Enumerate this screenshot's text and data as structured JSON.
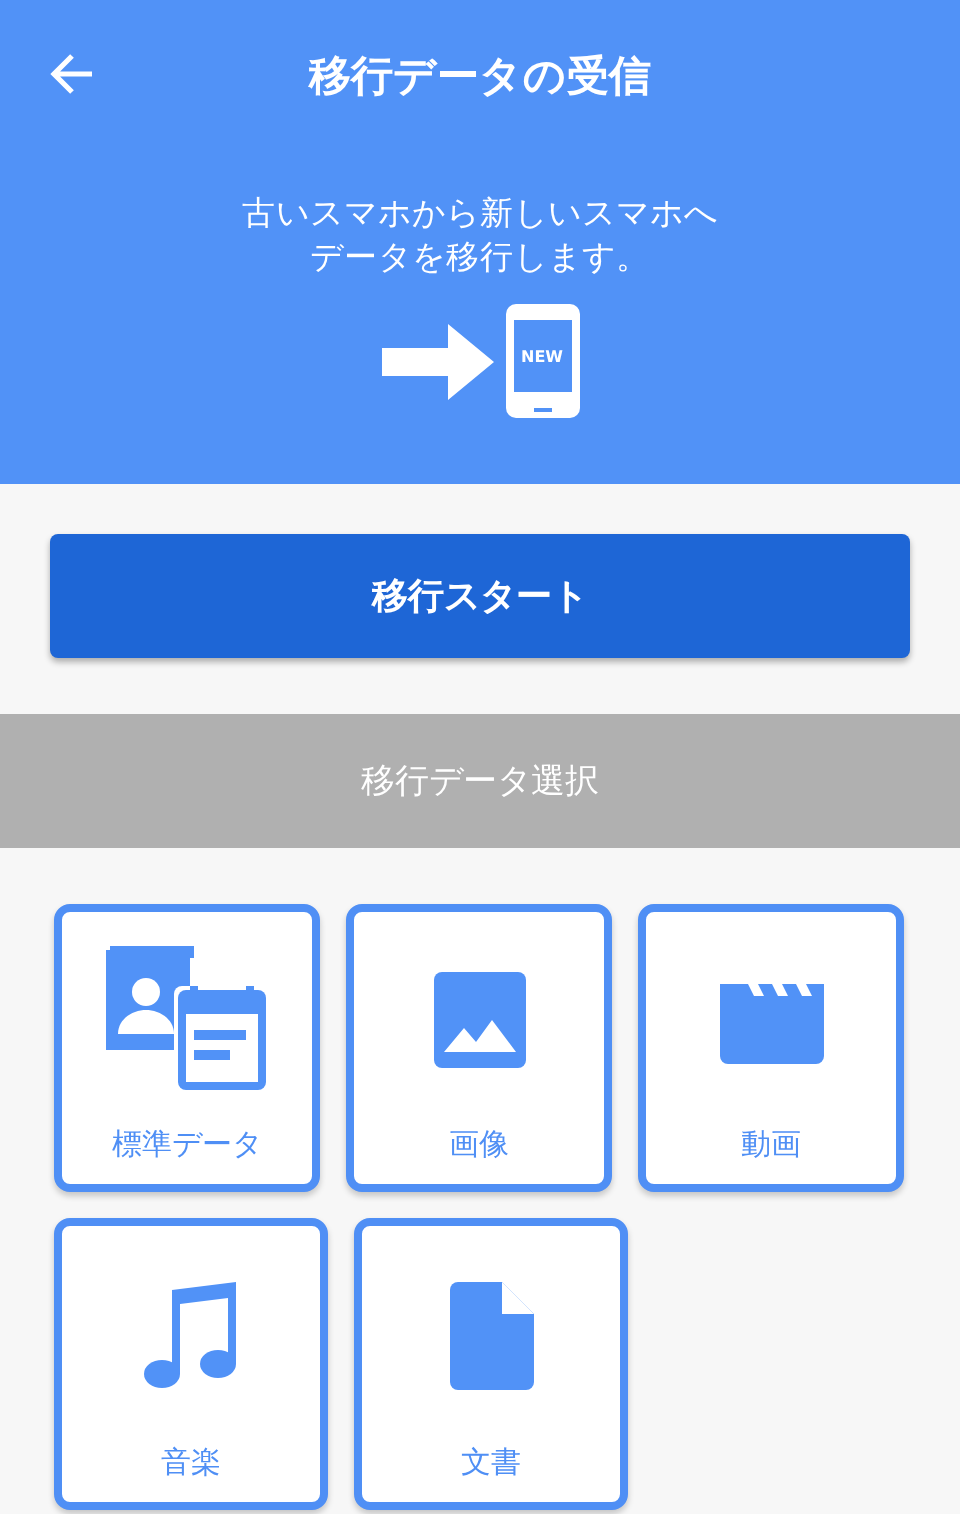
{
  "header": {
    "title": "移行データの受信",
    "message_lines": [
      "古いスマホから新しいスマホへ",
      "データを移行します。"
    ],
    "phone_badge": "NEW"
  },
  "start_button": {
    "label": "移行スタート"
  },
  "section": {
    "title": "移行データ選択"
  },
  "tiles": [
    {
      "kind": "standard",
      "label": "標準データ",
      "selected": true
    },
    {
      "kind": "image",
      "label": "画像",
      "selected": true
    },
    {
      "kind": "video",
      "label": "動画",
      "selected": true
    },
    {
      "kind": "music",
      "label": "音楽",
      "selected": true
    },
    {
      "kind": "document",
      "label": "文書",
      "selected": true
    }
  ]
}
